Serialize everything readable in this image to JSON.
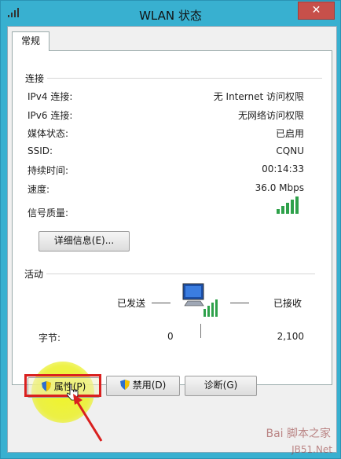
{
  "window": {
    "title": "WLAN 状态",
    "close": "✕"
  },
  "tabs": [
    {
      "label": "常规"
    }
  ],
  "connection": {
    "group_label": "连接",
    "rows": [
      {
        "label": "IPv4 连接:",
        "value": "无 Internet 访问权限"
      },
      {
        "label": "IPv6 连接:",
        "value": "无网络访问权限"
      },
      {
        "label": "媒体状态:",
        "value": "已启用"
      },
      {
        "label": "SSID:",
        "value": "CQNU"
      },
      {
        "label": "持续时间:",
        "value": "00:14:33"
      },
      {
        "label": "速度:",
        "value": "36.0 Mbps"
      }
    ],
    "signal_label": "信号质量:",
    "signal_bars": 5,
    "details_button": "详细信息(E)..."
  },
  "activity": {
    "group_label": "活动",
    "sent_label": "已发送",
    "received_label": "已接收",
    "bytes_label": "字节:",
    "bytes_sent": "0",
    "bytes_received": "2,100"
  },
  "buttons": {
    "properties": "属性(P)",
    "disable": "禁用(D)",
    "diagnose": "诊断(G)"
  },
  "watermark": {
    "line1": "Bai 脚本之家",
    "line2": "JB51.Net"
  },
  "colors": {
    "signal": "#2ea14a",
    "highlight": "#d9201f",
    "titlebar": "#38b0d0"
  }
}
